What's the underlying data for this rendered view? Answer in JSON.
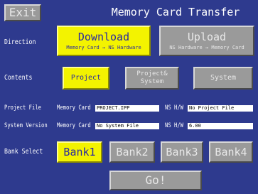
{
  "header": {
    "exit_label": "Exit",
    "title": "Memory Card Transfer"
  },
  "direction": {
    "label": "Direction",
    "download_label": "Download",
    "download_sub": "Memory Card → NS Hardware",
    "upload_label": "Upload",
    "upload_sub": "NS Hardware → Memory Card",
    "selected": "Download"
  },
  "contents": {
    "label": "Contents",
    "project_label": "Project",
    "project_system_line1": "Project&",
    "project_system_line2": "System",
    "system_label": "System",
    "selected": "Project"
  },
  "project_file": {
    "label": "Project File",
    "memory_card_label": "Memory Card",
    "memory_card_value": "PROJECT.IPP",
    "ns_label": "NS H/W",
    "ns_value": "No Project File"
  },
  "system_version": {
    "label": "System Version",
    "memory_card_label": "Memory Card",
    "memory_card_value": "No System File",
    "ns_label": "NS H/W",
    "ns_value": "6.00"
  },
  "bank_select": {
    "label": "Bank Select",
    "banks": [
      "Bank1",
      "Bank2",
      "Bank3",
      "Bank4"
    ],
    "selected": "Bank1"
  },
  "go_label": "Go!",
  "colors": {
    "background": "#2e3a8e",
    "selected": "#f3f300",
    "unselected": "#9a9a9a",
    "selected_text": "#2a2aa0"
  }
}
